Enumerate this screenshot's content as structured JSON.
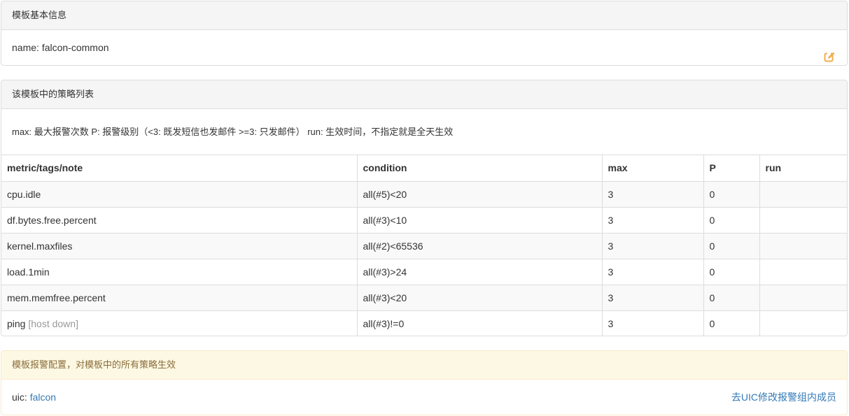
{
  "template_info": {
    "heading": "模板基本信息",
    "name_label": "name: ",
    "name_value": "falcon-common",
    "edit_icon": "edit-icon"
  },
  "strategies": {
    "heading": "该模板中的策略列表",
    "legend": "max: 最大报警次数 P: 报警级别（<3: 既发短信也发邮件 >=3: 只发邮件） run: 生效时间，不指定就是全天生效",
    "columns": [
      "metric/tags/note",
      "condition",
      "max",
      "P",
      "run"
    ],
    "rows": [
      {
        "metric": "cpu.idle",
        "note": "",
        "condition": "all(#5)<20",
        "max": "3",
        "p": "0",
        "run": ""
      },
      {
        "metric": "df.bytes.free.percent",
        "note": "",
        "condition": "all(#3)<10",
        "max": "3",
        "p": "0",
        "run": ""
      },
      {
        "metric": "kernel.maxfiles",
        "note": "",
        "condition": "all(#2)<65536",
        "max": "3",
        "p": "0",
        "run": ""
      },
      {
        "metric": "load.1min",
        "note": "",
        "condition": "all(#3)>24",
        "max": "3",
        "p": "0",
        "run": ""
      },
      {
        "metric": "mem.memfree.percent",
        "note": "",
        "condition": "all(#3)<20",
        "max": "3",
        "p": "0",
        "run": ""
      },
      {
        "metric": "ping",
        "note": "[host down]",
        "condition": "all(#3)!=0",
        "max": "3",
        "p": "0",
        "run": ""
      }
    ]
  },
  "alarm_config": {
    "heading": "模板报警配置，对模板中的所有策略生效",
    "uic_label": "uic: ",
    "uic_value": "falcon",
    "uic_link": "去UIC修改报警组内成员"
  },
  "colors": {
    "accent": "#f0ad4e",
    "link": "#337ab7",
    "warning_bg": "#fcf8e3",
    "warning_text": "#8a6d3b"
  }
}
